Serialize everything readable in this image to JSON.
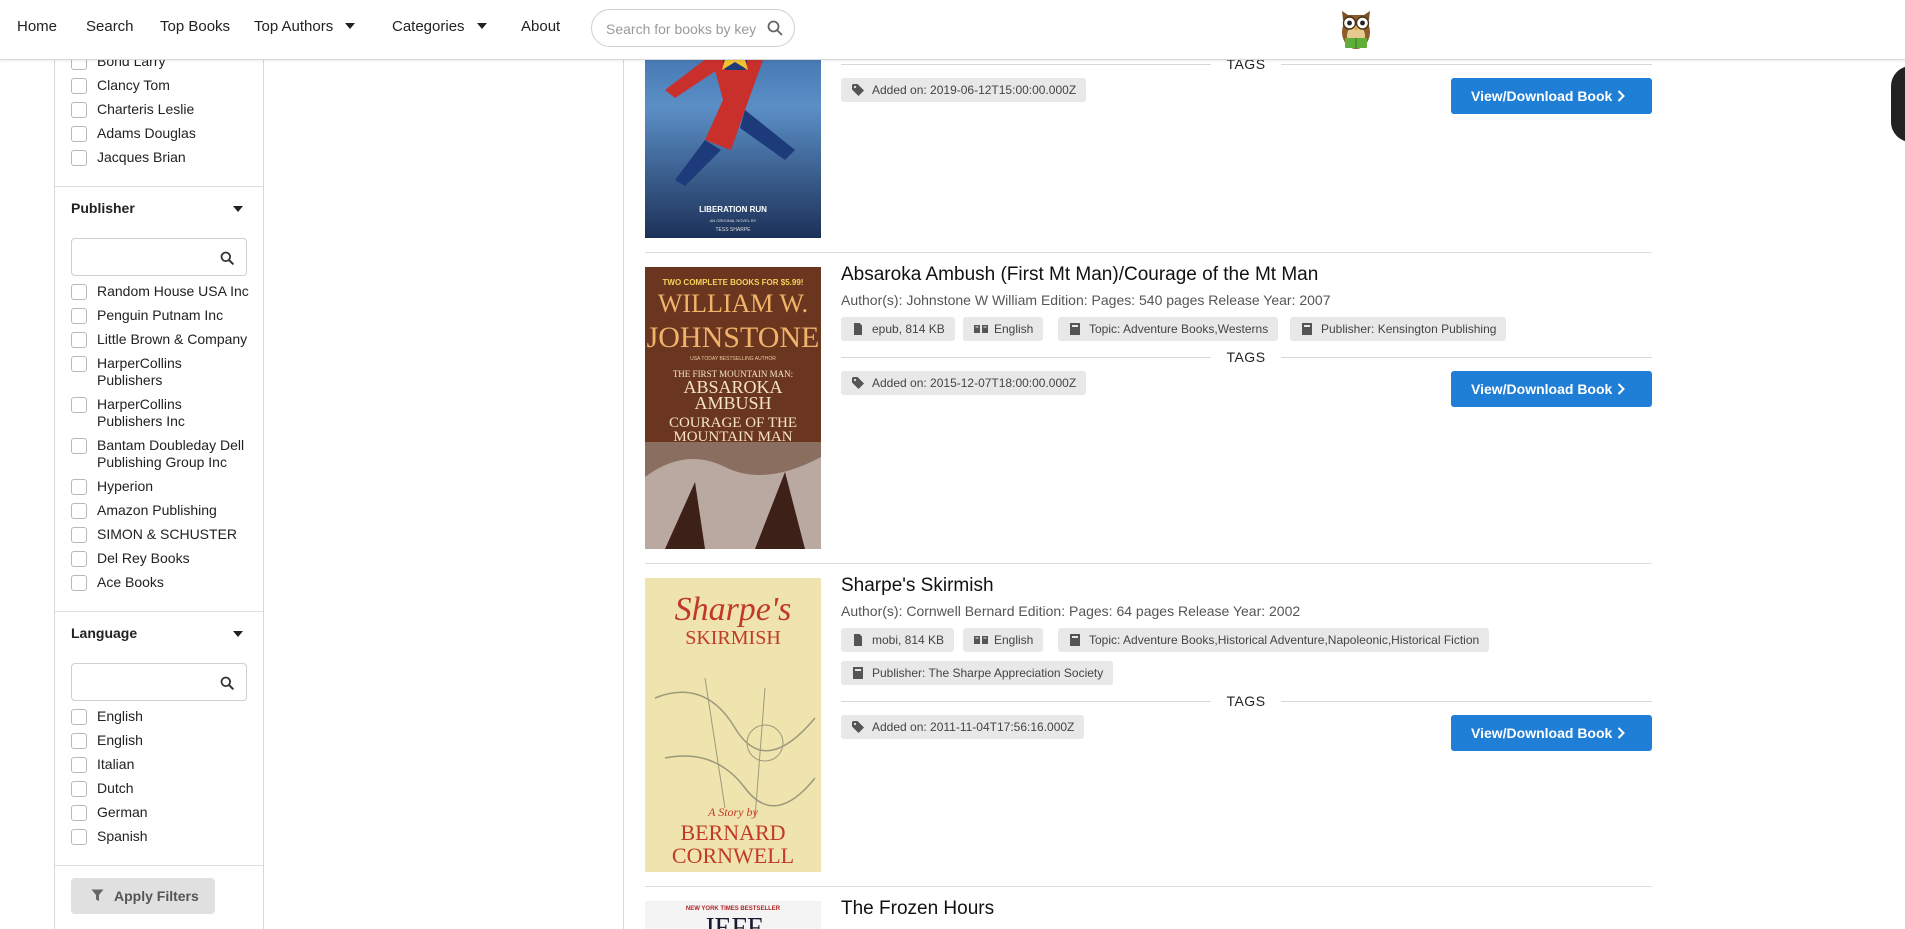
{
  "nav": {
    "home": "Home",
    "search": "Search",
    "top_books": "Top Books",
    "top_authors": "Top Authors",
    "categories": "Categories",
    "about": "About",
    "search_placeholder": "Search for books by keyword"
  },
  "sidebar": {
    "authors": [
      "Bond Larry",
      "Clancy Tom",
      "Charteris Leslie",
      "Adams Douglas",
      "Jacques Brian"
    ],
    "publisher": {
      "title": "Publisher",
      "items": [
        "Random House USA Inc",
        "Penguin Putnam Inc",
        "Little Brown & Company",
        "HarperCollins Publishers",
        "HarperCollins Publishers Inc",
        "Bantam Doubleday Dell Publishing Group Inc",
        "Hyperion",
        "Amazon Publishing",
        "SIMON & SCHUSTER",
        "Del Rey Books",
        "Ace Books"
      ]
    },
    "language": {
      "title": "Language",
      "items": [
        "English",
        "English",
        "Italian",
        "Dutch",
        "German",
        "Spanish"
      ]
    },
    "apply_label": "Apply Filters"
  },
  "books": [
    {
      "cover_text": [
        "LIBERATION RUN",
        "AN ORIGINAL NOVEL BY",
        "TESS SHARPE"
      ],
      "tags_label": "TAGS",
      "added": "Added on: 2019-06-12T15:00:00.000Z",
      "button": "View/Download Book"
    },
    {
      "title": "Absaroka Ambush (First Mt Man)/Courage of the Mt Man",
      "meta": "Author(s): Johnstone W William   Edition:   Pages: 540 pages   Release Year: 2007",
      "format": "epub, 814 KB",
      "language": "English",
      "topic": "Topic: Adventure Books,Westerns",
      "publisher": "Publisher: Kensington Publishing",
      "tags_label": "TAGS",
      "added": "Added on: 2015-12-07T18:00:00.000Z",
      "button": "View/Download Book",
      "cover_text": [
        "TWO COMPLETE BOOKS FOR $5.99!",
        "WILLIAM W.",
        "JOHNSTONE",
        "USA TODAY BESTSELLING AUTHOR",
        "THE FIRST MOUNTAIN MAN:",
        "ABSAROKA",
        "AMBUSH",
        "COURAGE OF THE",
        "MOUNTAIN MAN"
      ]
    },
    {
      "title": "Sharpe's Skirmish",
      "meta": "Author(s): Cornwell Bernard   Edition:   Pages: 64 pages   Release Year: 2002",
      "format": "mobi, 814 KB",
      "language": "English",
      "topic": "Topic: Adventure Books,Historical Adventure,Napoleonic,Historical Fiction",
      "publisher": "Publisher: The Sharpe Appreciation Society",
      "tags_label": "TAGS",
      "added": "Added on: 2011-11-04T17:56:16.000Z",
      "button": "View/Download Book",
      "cover_text": [
        "Sharpe's",
        "SKIRMISH",
        "A Story by",
        "BERNARD",
        "CORNWELL"
      ]
    },
    {
      "title": "The Frozen Hours",
      "cover_text": [
        "NEW YORK TIMES BESTSELLER",
        "JEFF"
      ]
    }
  ],
  "colors": {
    "accent": "#1f7ed6",
    "tag_bg": "#e8e8e8",
    "apply_bg": "#e0e0e0"
  }
}
